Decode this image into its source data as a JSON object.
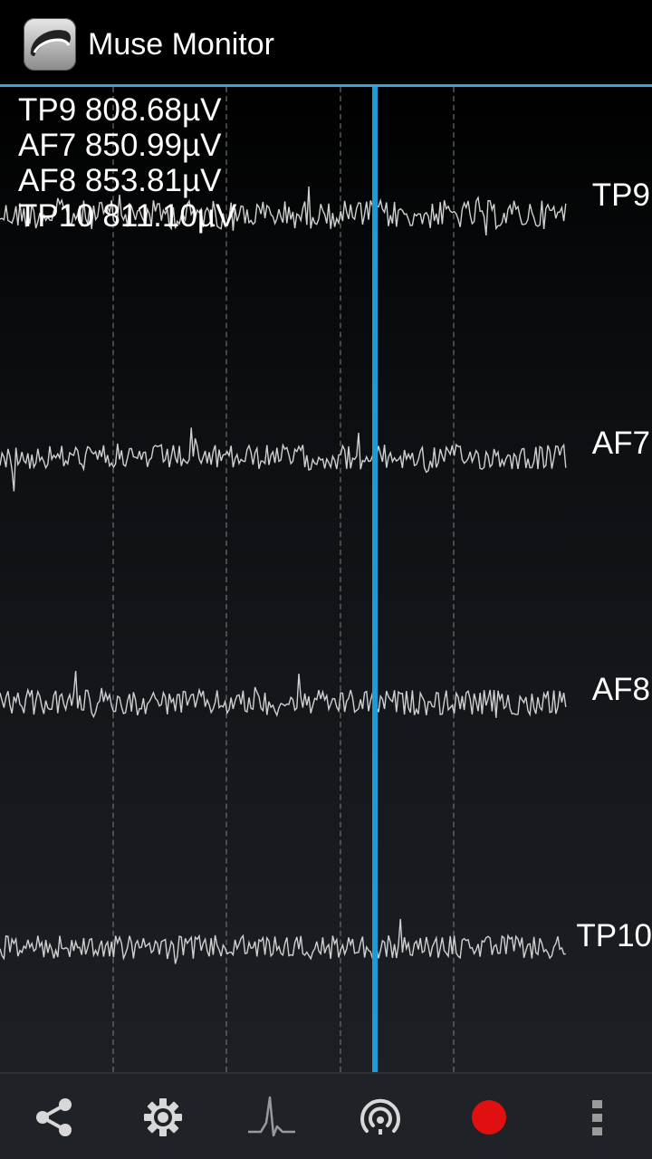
{
  "app": {
    "title": "Muse Monitor",
    "icon": "muse-headband-icon"
  },
  "readouts": [
    {
      "channel": "TP9",
      "value": "808.68µV",
      "text": "TP9 808.68µV"
    },
    {
      "channel": "AF7",
      "value": "850.99µV",
      "text": "AF7 850.99µV"
    },
    {
      "channel": "AF8",
      "value": "853.81µV",
      "text": "AF8 853.81µV"
    },
    {
      "channel": "TP10",
      "value": "811.10µV",
      "text": "TP10 811.10µV"
    }
  ],
  "channels": [
    {
      "label": "TP9"
    },
    {
      "label": "AF7"
    },
    {
      "label": "AF8"
    },
    {
      "label": "TP10"
    }
  ],
  "toolbar": {
    "items": [
      {
        "name": "share",
        "icon": "share-icon"
      },
      {
        "name": "settings",
        "icon": "gear-icon"
      },
      {
        "name": "waveform",
        "icon": "waveform-icon"
      },
      {
        "name": "connect",
        "icon": "broadcast-icon"
      },
      {
        "name": "record",
        "icon": "record-icon"
      },
      {
        "name": "overflow",
        "icon": "more-vert-icon"
      }
    ]
  },
  "colors": {
    "accent": "#33a6d6",
    "cursor": "#1e9ad4",
    "record": "#e01010",
    "trace": "#d0d0d0"
  }
}
